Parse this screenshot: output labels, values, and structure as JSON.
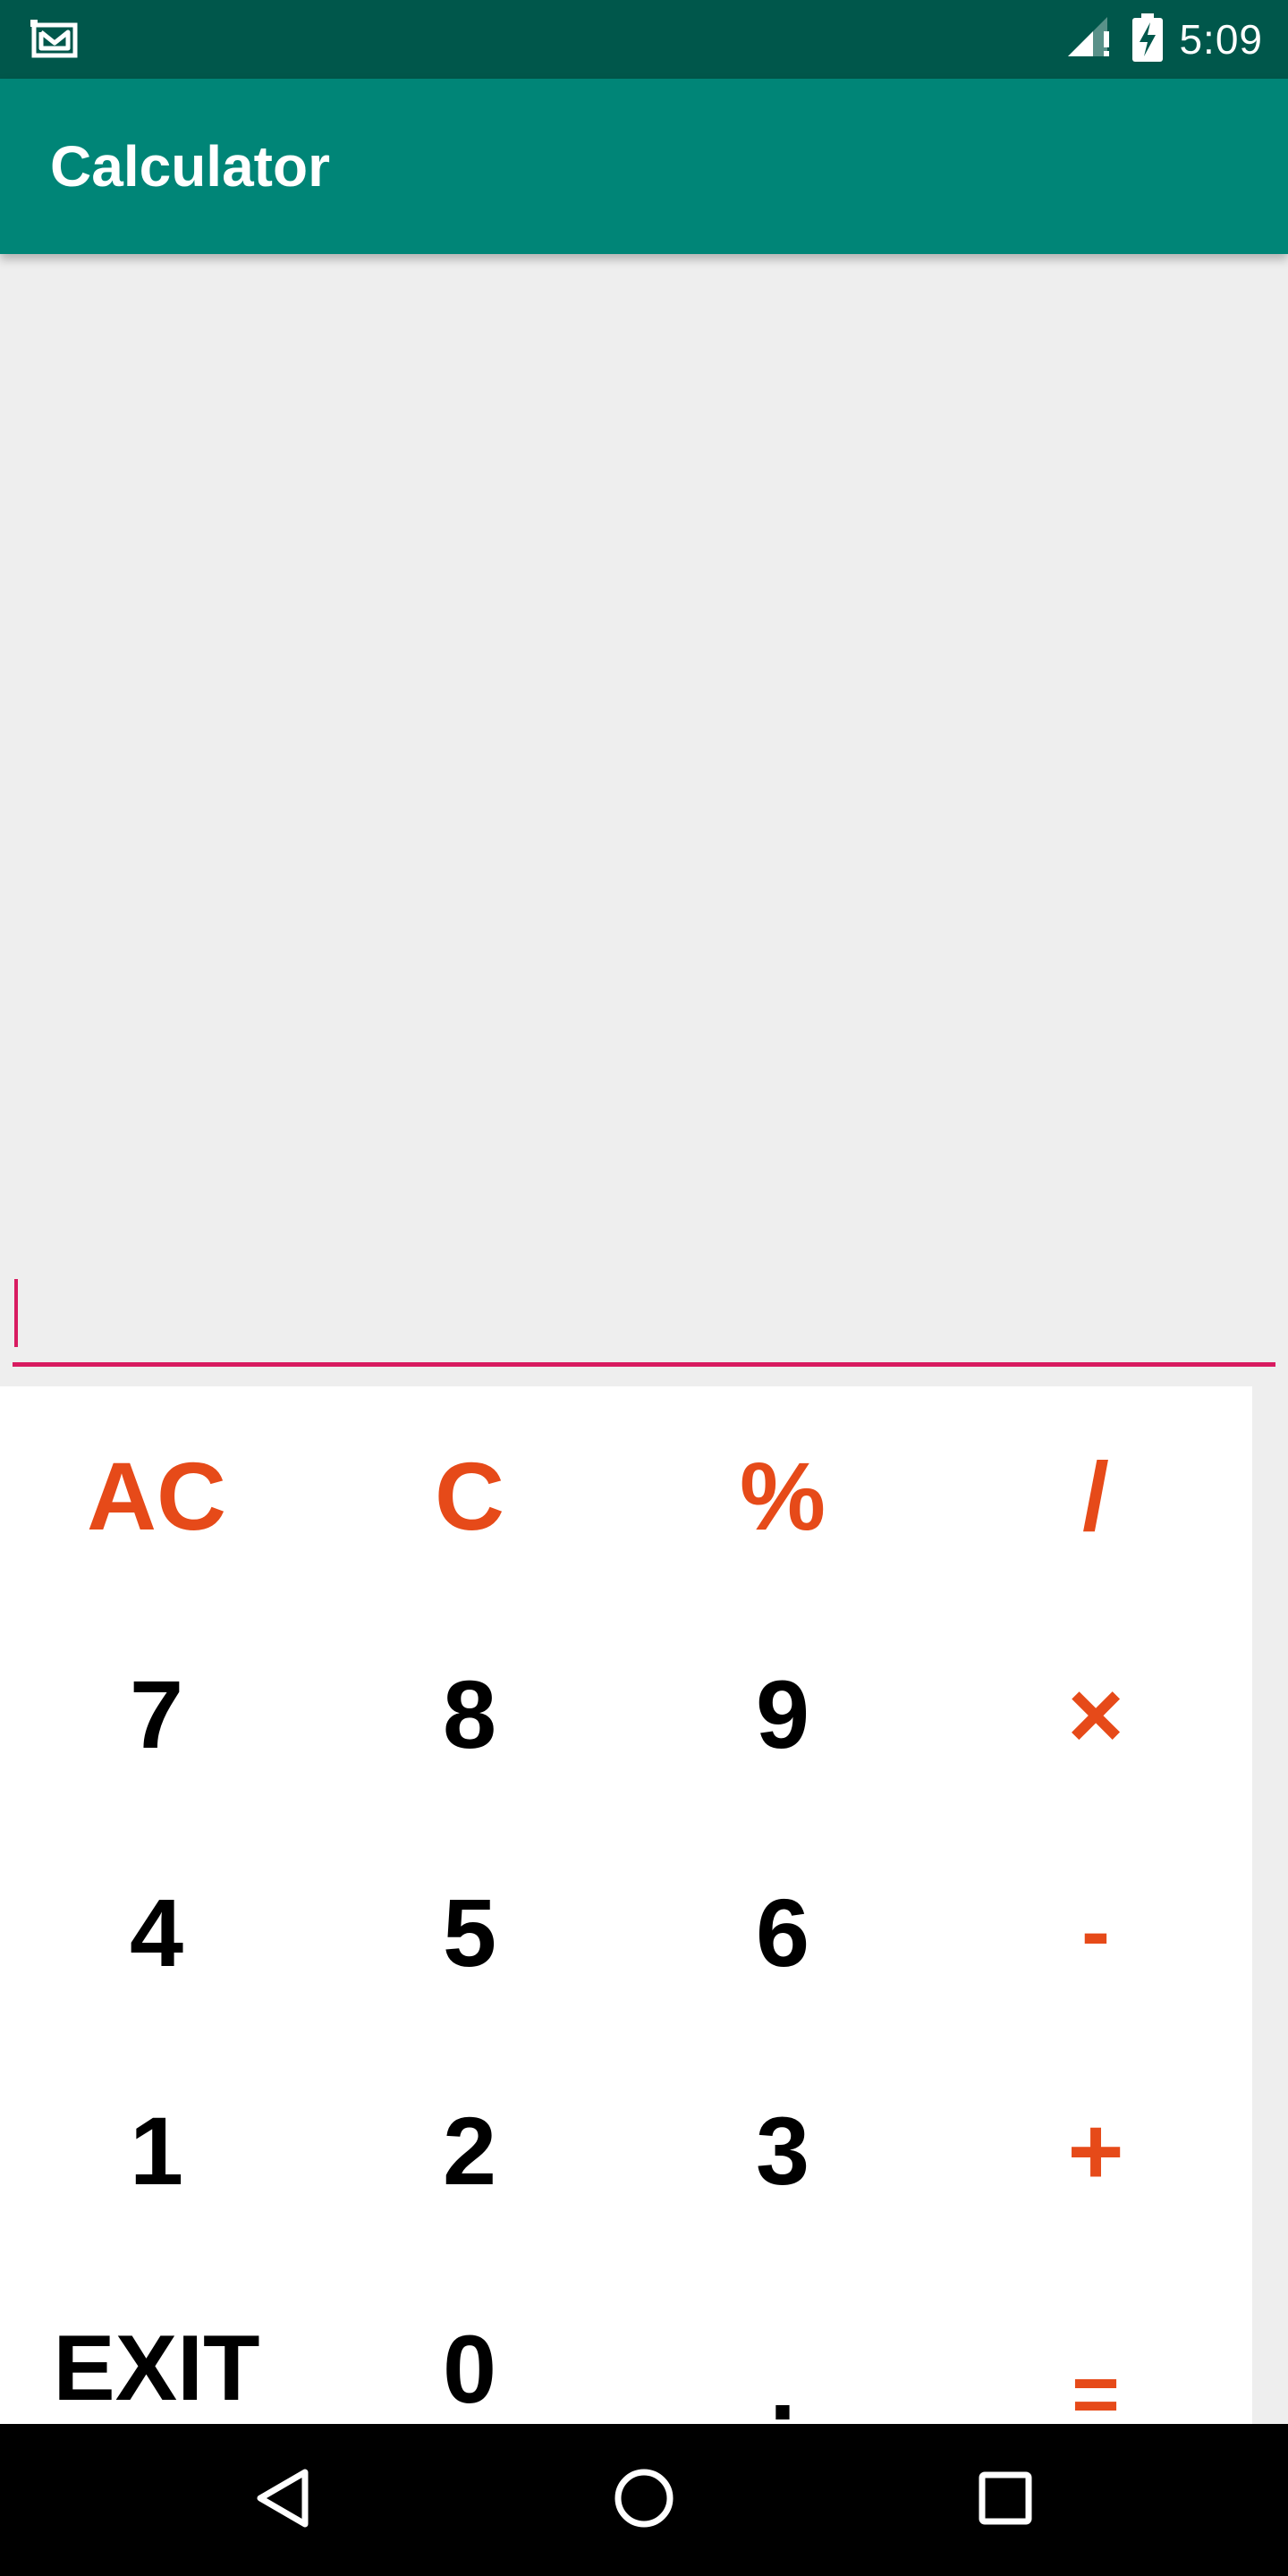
{
  "status_bar": {
    "time": "5:09",
    "left_icon": "gmail-icon",
    "right_icons": [
      "signal-alert-icon",
      "battery-charging-icon"
    ]
  },
  "app_bar": {
    "title": "Calculator"
  },
  "display": {
    "value": "",
    "placeholder": "",
    "underline_color": "#d81b60"
  },
  "keypad": {
    "rows": [
      [
        {
          "label": "AC",
          "kind": "op"
        },
        {
          "label": "C",
          "kind": "op"
        },
        {
          "label": "%",
          "kind": "op"
        },
        {
          "label": "/",
          "kind": "op"
        }
      ],
      [
        {
          "label": "7",
          "kind": "digit"
        },
        {
          "label": "8",
          "kind": "digit"
        },
        {
          "label": "9",
          "kind": "digit"
        },
        {
          "label": "×",
          "kind": "op"
        }
      ],
      [
        {
          "label": "4",
          "kind": "digit"
        },
        {
          "label": "5",
          "kind": "digit"
        },
        {
          "label": "6",
          "kind": "digit"
        },
        {
          "label": "-",
          "kind": "op"
        }
      ],
      [
        {
          "label": "1",
          "kind": "digit"
        },
        {
          "label": "2",
          "kind": "digit"
        },
        {
          "label": "3",
          "kind": "digit"
        },
        {
          "label": "+",
          "kind": "op"
        }
      ],
      [
        {
          "label": "EXIT",
          "kind": "digit"
        },
        {
          "label": "0",
          "kind": "digit"
        },
        {
          "label": ".",
          "kind": "digit"
        },
        {
          "label": "=",
          "kind": "op"
        }
      ]
    ]
  },
  "nav_bar": {
    "buttons": [
      "back-icon",
      "home-icon",
      "recents-icon"
    ]
  },
  "colors": {
    "status_bar": "#00574b",
    "app_bar": "#008577",
    "accent": "#d81b60",
    "operator": "#e64a19",
    "background": "#eeeeee",
    "keypad_bg": "#ffffff"
  }
}
